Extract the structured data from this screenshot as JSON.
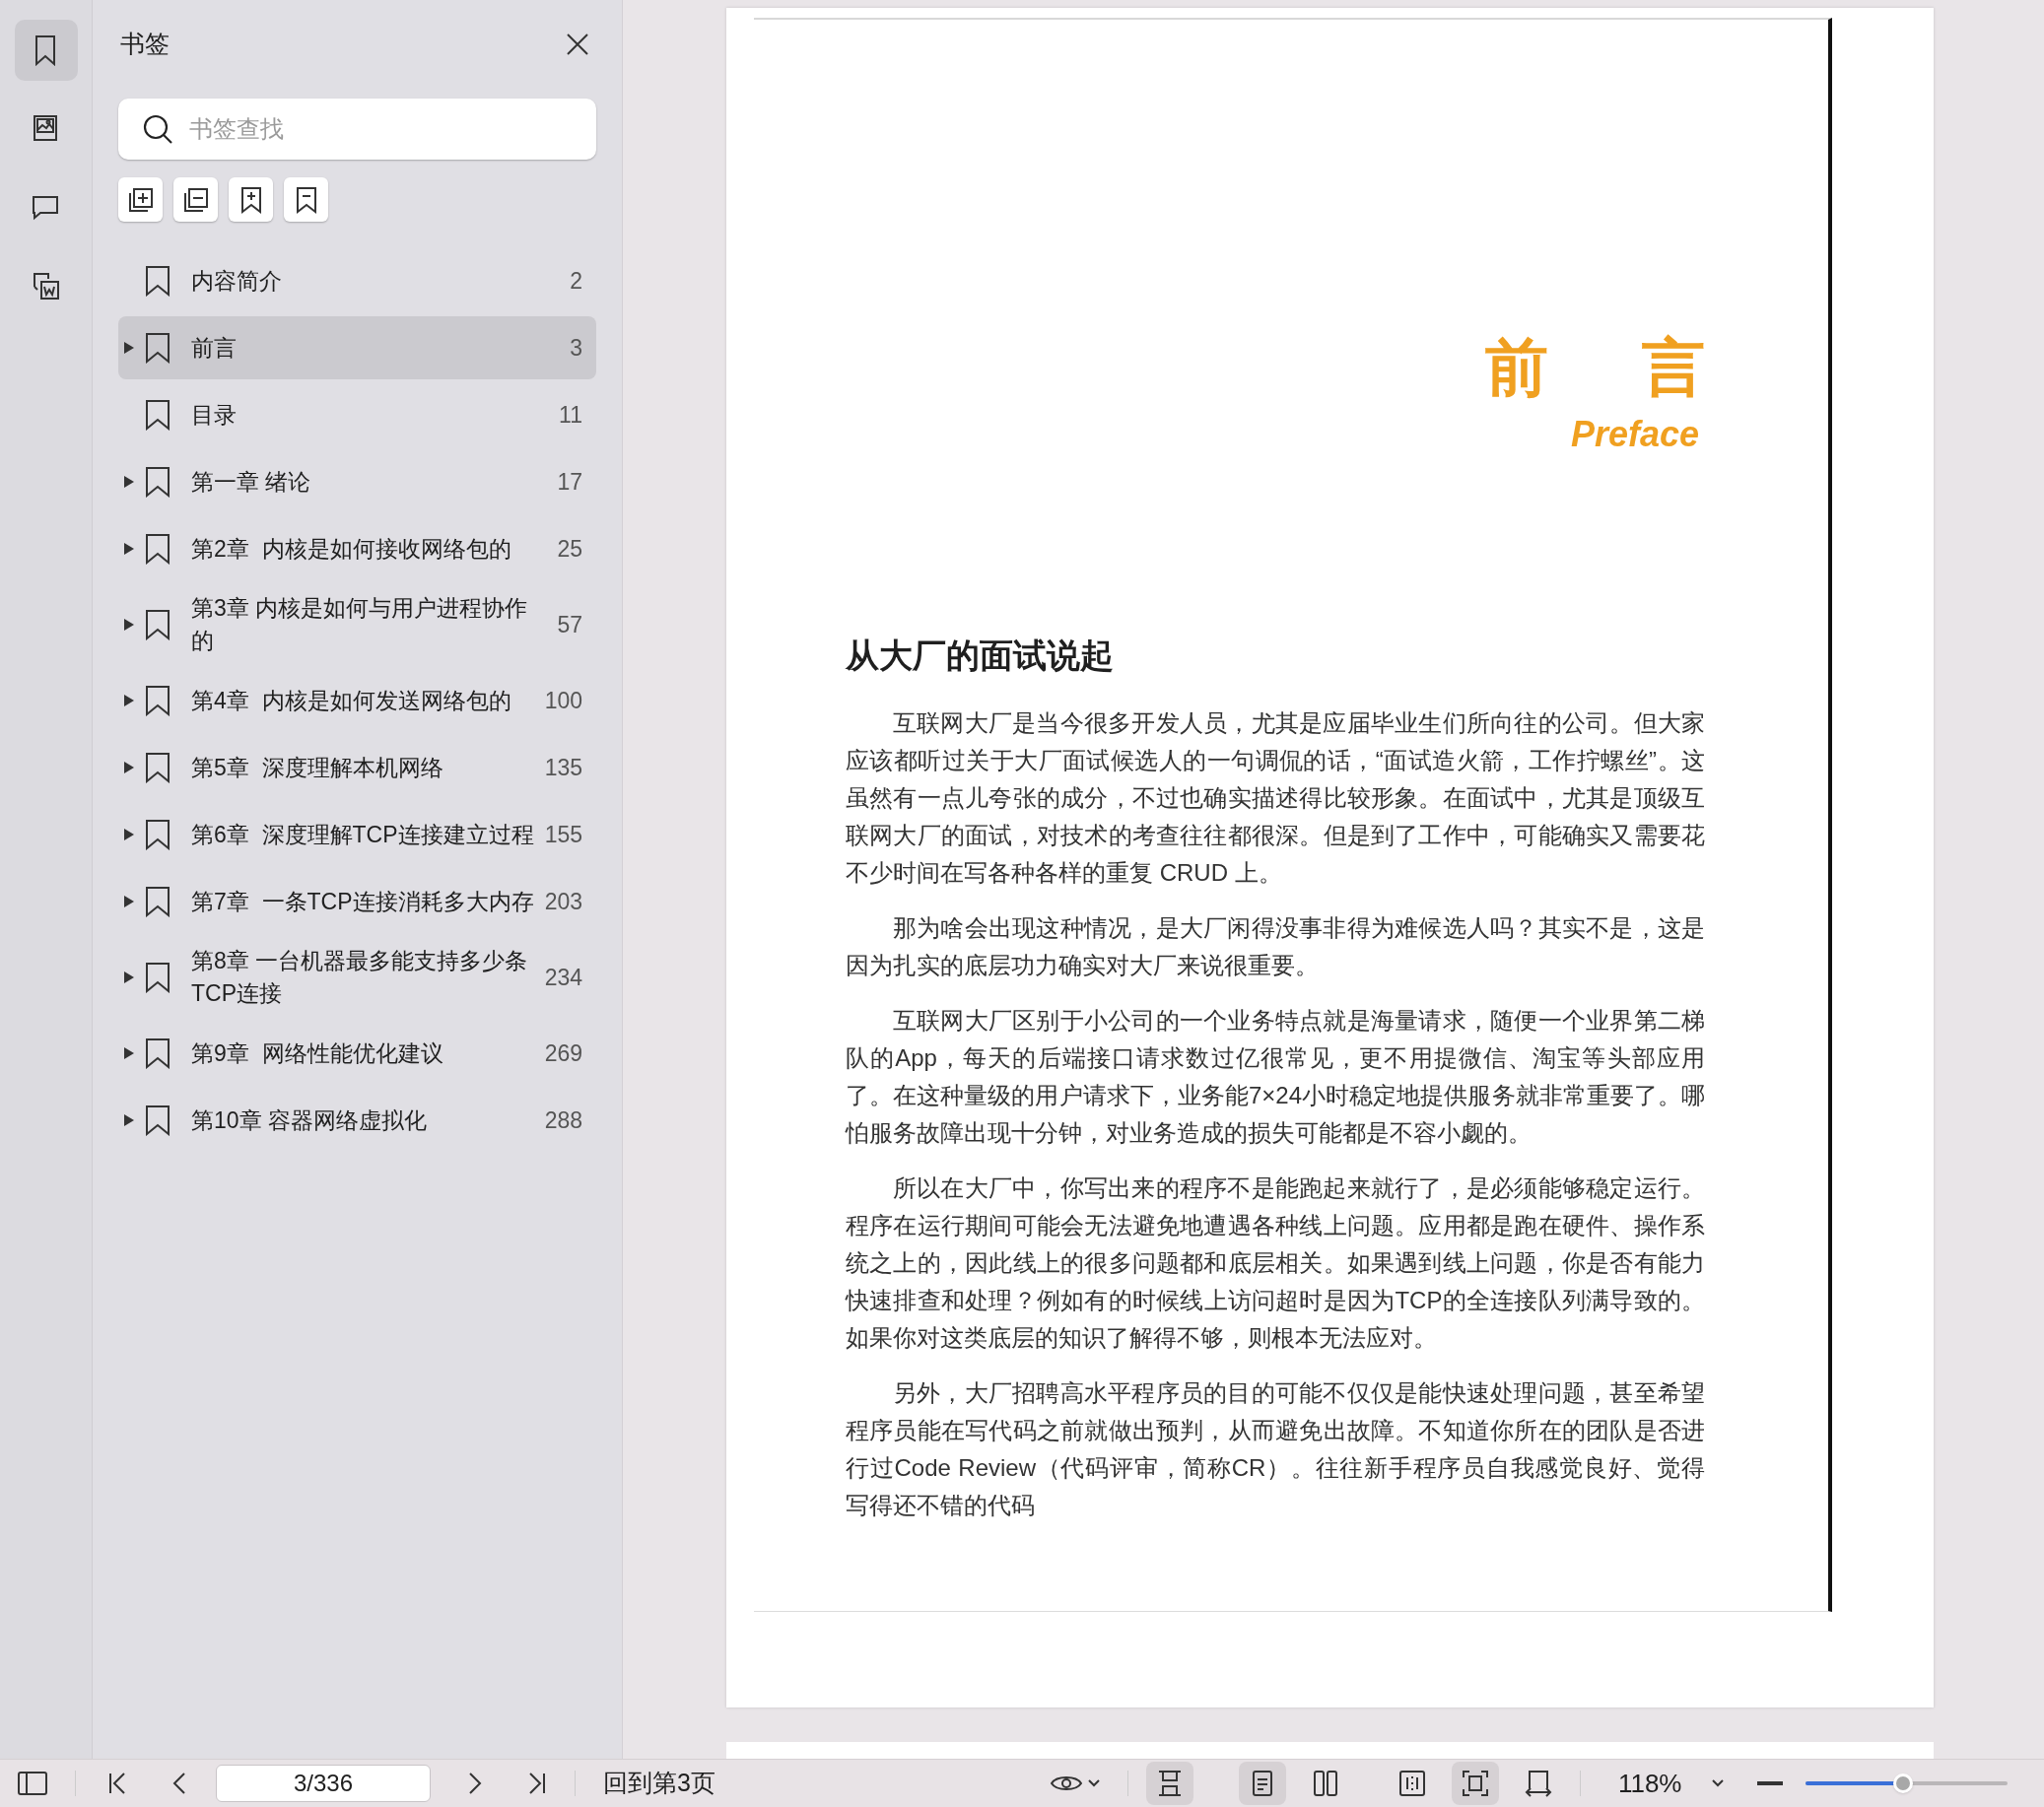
{
  "rail": [
    {
      "kind": "bookmark",
      "selected": true
    },
    {
      "kind": "image",
      "selected": false
    },
    {
      "kind": "comment",
      "selected": false
    },
    {
      "kind": "convert",
      "selected": false
    }
  ],
  "sidebar": {
    "title": "书签",
    "search": {
      "placeholder": "书签查找"
    },
    "tools": [
      {
        "kind": "expand"
      },
      {
        "kind": "collapse"
      },
      {
        "kind": "add"
      },
      {
        "kind": "remove"
      }
    ],
    "bookmarks": [
      {
        "label": "内容简介",
        "page": "2",
        "has_children": false,
        "selected": false
      },
      {
        "label": "前言",
        "page": "3",
        "has_children": true,
        "selected": true
      },
      {
        "label": "目录",
        "page": "11",
        "has_children": false,
        "selected": false
      },
      {
        "label": "第一章 绪论",
        "page": "17",
        "has_children": true,
        "selected": false
      },
      {
        "label": "第2章  内核是如何接收网络包的",
        "page": "25",
        "has_children": true,
        "selected": false
      },
      {
        "label": "第3章 内核是如何与用户进程协作的",
        "page": "57",
        "has_children": true,
        "selected": false
      },
      {
        "label": "第4章  内核是如何发送网络包的",
        "page": "100",
        "has_children": true,
        "selected": false
      },
      {
        "label": "第5章  深度理解本机网络",
        "page": "135",
        "has_children": true,
        "selected": false
      },
      {
        "label": "第6章  深度理解TCP连接建立过程",
        "page": "155",
        "has_children": true,
        "selected": false
      },
      {
        "label": "第7章  一条TCP连接消耗多大内存",
        "page": "203",
        "has_children": true,
        "selected": false
      },
      {
        "label": "第8章 一台机器最多能支持多少条 TCP连接",
        "page": "234",
        "has_children": true,
        "selected": false
      },
      {
        "label": "第9章  网络性能优化建议",
        "page": "269",
        "has_children": true,
        "selected": false
      },
      {
        "label": "第10章 容器网络虚拟化",
        "page": "288",
        "has_children": true,
        "selected": false
      }
    ]
  },
  "page": {
    "title": "前 言",
    "subtitle": "Preface",
    "heading": "从大厂的面试说起",
    "paragraphs": [
      "互联网大厂是当今很多开发人员，尤其是应届毕业生们所向往的公司。但大家应该都听过关于大厂面试候选人的一句调侃的话，“面试造火箭，工作拧螺丝”。这虽然有一点儿夸张的成分，不过也确实描述得比较形象。在面试中，尤其是顶级互联网大厂的面试，对技术的考查往往都很深。但是到了工作中，可能确实又需要花不少时间在写各种各样的重复 CRUD 上。",
      "那为啥会出现这种情况，是大厂闲得没事非得为难候选人吗？其实不是，这是因为扎实的底层功力确实对大厂来说很重要。",
      "互联网大厂区别于小公司的一个业务特点就是海量请求，随便一个业界第二梯队的App，每天的后端接口请求数过亿很常见，更不用提微信、淘宝等头部应用了。在这种量级的用户请求下，业务能7×24小时稳定地提供服务就非常重要了。哪怕服务故障出现十分钟，对业务造成的损失可能都是不容小觑的。",
      "所以在大厂中，你写出来的程序不是能跑起来就行了，是必须能够稳定运行。程序在运行期间可能会无法避免地遭遇各种线上问题。应用都是跑在硬件、操作系统之上的，因此线上的很多问题都和底层相关。如果遇到线上问题，你是否有能力快速排查和处理？例如有的时候线上访问超时是因为TCP的全连接队列满导致的。如果你对这类底层的知识了解得不够，则根本无法应对。",
      "另外，大厂招聘高水平程序员的目的可能不仅仅是能快速处理问题，甚至希望程序员能在写代码之前就做出预判，从而避免出故障。不知道你所在的团队是否进行过Code Review（代码评审，简称CR）。往往新手程序员自我感觉良好、觉得写得还不错的代码"
    ]
  },
  "bottom_bar": {
    "page_field": "3/336",
    "goto_link": "回到第3页",
    "view_buttons": [
      {
        "kind": "fit-height",
        "selected": true
      },
      {
        "kind": "single",
        "selected": true
      },
      {
        "kind": "double",
        "selected": false
      },
      {
        "kind": "spread",
        "selected": false
      },
      {
        "kind": "fit",
        "selected": true
      },
      {
        "kind": "width",
        "selected": false
      }
    ],
    "zoom": "118%",
    "zoom_slider": {
      "level": 0.48
    }
  }
}
